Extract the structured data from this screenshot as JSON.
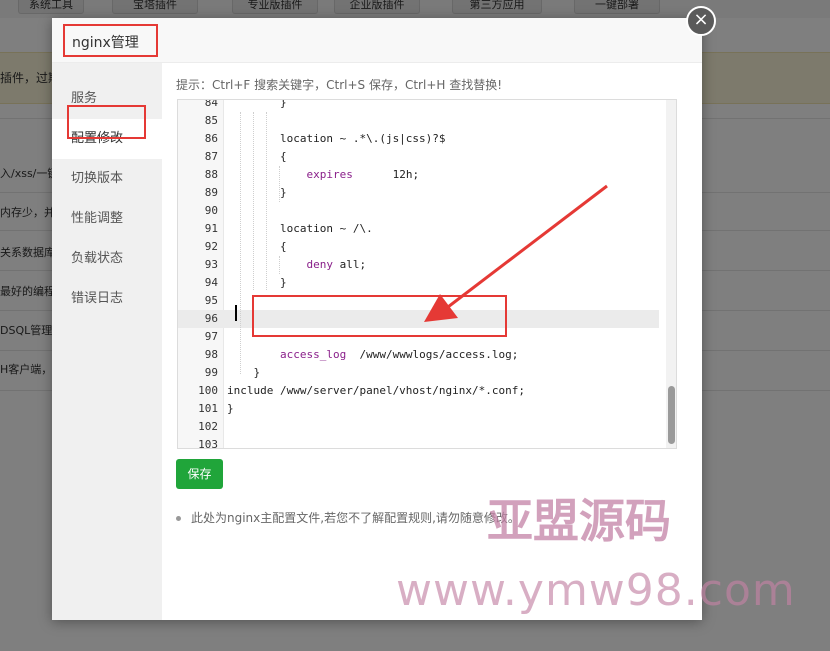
{
  "background": {
    "tabs": [
      "系统工具",
      "宝塔插件",
      "专业版插件",
      "企业版插件",
      "第三方应用",
      "一键部署"
    ],
    "notice": "插件，过期",
    "rows": [
      "入/xss/一键",
      "内存少，并",
      "关系数据库",
      "最好的编程",
      "DSQL管理工",
      "H客户端，"
    ]
  },
  "modal": {
    "title": "nginx管理",
    "close_glyph": "×",
    "nav": [
      "服务",
      "配置修改",
      "切换版本",
      "性能调整",
      "负载状态",
      "错误日志"
    ],
    "active_nav_index": 1,
    "tip": "提示：Ctrl+F 搜索关键字，Ctrl+S 保存，Ctrl+H 查找替换!",
    "editor": {
      "active_line": "96",
      "lines": [
        {
          "n": "84",
          "code": "        }"
        },
        {
          "n": "85",
          "code": ""
        },
        {
          "n": "86",
          "code": "        location ~ .*\\.(js|css)?$"
        },
        {
          "n": "87",
          "code": "        {"
        },
        {
          "n": "88",
          "code": "            expires      12h;"
        },
        {
          "n": "89",
          "code": "        }"
        },
        {
          "n": "90",
          "code": ""
        },
        {
          "n": "91",
          "code": "        location ~ /\\."
        },
        {
          "n": "92",
          "code": "        {"
        },
        {
          "n": "93",
          "code": "            deny all;"
        },
        {
          "n": "94",
          "code": "        }"
        },
        {
          "n": "95",
          "code": ""
        },
        {
          "n": "96",
          "code": ""
        },
        {
          "n": "97",
          "code": ""
        },
        {
          "n": "98",
          "code": "        access_log  /www/wwwlogs/access.log;"
        },
        {
          "n": "99",
          "code": "    }"
        },
        {
          "n": "100",
          "code": "include /www/server/panel/vhost/nginx/*.conf;"
        },
        {
          "n": "101",
          "code": "}"
        },
        {
          "n": "102",
          "code": ""
        },
        {
          "n": "103",
          "code": ""
        }
      ]
    },
    "save_label": "保存",
    "note": "此处为nginx主配置文件,若您不了解配置规则,请勿随意修改。"
  },
  "colors": {
    "save_button": "#20a53a",
    "annotation_red": "#e53935",
    "keyword_purple": "#8a1f8a"
  },
  "watermark": {
    "line1": "亚盟源码",
    "line2": "www.ymw98.com"
  }
}
